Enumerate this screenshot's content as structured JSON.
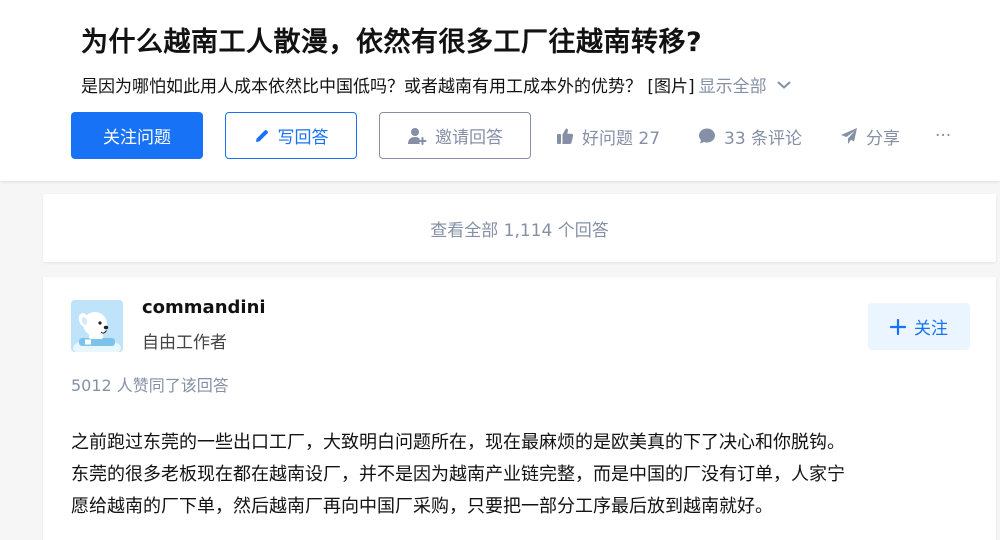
{
  "question": {
    "title": "为什么越南工人散漫，依然有很多工厂往越南转移?",
    "description": "是因为哪怕如此用人成本依然比中国低吗？或者越南有用工成本外的优势？ [图片]",
    "show_all_label": "显示全部"
  },
  "actions": {
    "follow_label": "关注问题",
    "write_label": "写回答",
    "invite_label": "邀请回答",
    "good_question_label": "好问题 27",
    "comments_label": "33 条评论",
    "share_label": "分享",
    "more_label": "···"
  },
  "answers_summary": {
    "view_all_label": "查看全部 1,114 个回答"
  },
  "answer": {
    "author_name": "commandini",
    "author_bio": "自由工作者",
    "follow_label": "关注",
    "votes_label": "5012 人赞同了该回答",
    "lines": [
      "之前跑过东莞的一些出口工厂，大致明白问题所在，现在最麻烦的是欧美真的下了决心和你脱钩。",
      "东莞的很多老板现在都在越南设厂，并不是因为越南产业链完整，而是中国的厂没有订单，人家宁",
      "愿给越南的厂下单，然后越南厂再向中国厂采购，只要把一部分工序最后放到越南就好。"
    ]
  },
  "colors": {
    "brand": "#1772f6",
    "muted": "#8590a6",
    "text": "#121212",
    "page_bg": "#f6f6f6"
  },
  "icons": {
    "write": "pencil-icon",
    "invite": "invite-user-icon",
    "good": "thumbs-up-icon",
    "comment": "comment-bubble-icon",
    "share": "paper-plane-icon",
    "more": "more-dots-icon",
    "expand": "chevron-down-icon",
    "follow_author": "plus-icon"
  }
}
